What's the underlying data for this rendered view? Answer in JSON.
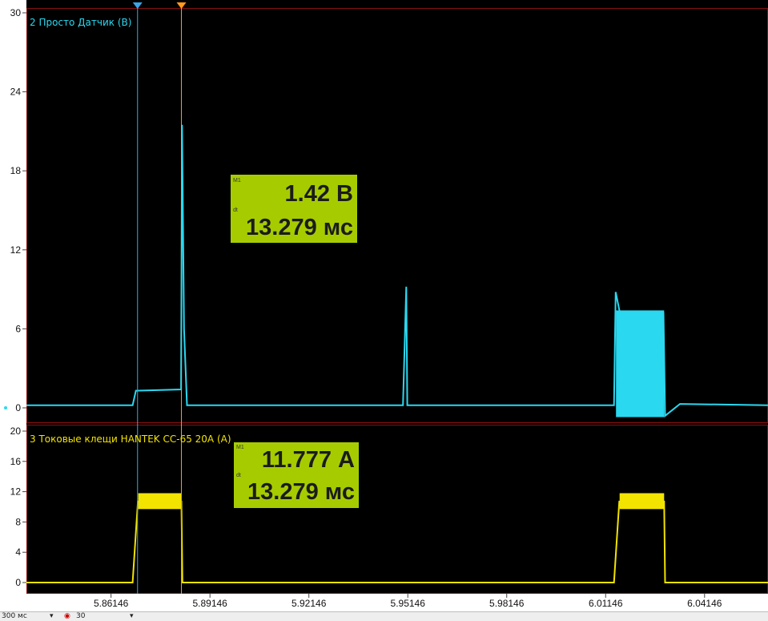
{
  "channels": {
    "ch2": {
      "label": "2 Просто Датчик (В)",
      "color": "#2ad8f0"
    },
    "ch3": {
      "label": "3 Токовые клещи HANTEK CC-65 20A (A)",
      "color": "#f2e300"
    }
  },
  "measurements": {
    "m1": {
      "tag1": "M1",
      "value": "1.42 В",
      "tag2": "dt",
      "dt": "13.279 мс"
    },
    "m2": {
      "tag1": "M1",
      "value": "11.777 А",
      "tag2": "dt",
      "dt": "13.279 мс"
    }
  },
  "cursors": {
    "a": {
      "color": "#3aa6e6",
      "t": 5.8695
    },
    "b": {
      "color": "#ff9a1e",
      "t": 5.8828
    }
  },
  "statusbar": {
    "timebase": "300 мс",
    "count": "30"
  },
  "colors": {
    "grid_border": "#8a0f0f",
    "measure_bg": "#a6cc00"
  },
  "chart_data": [
    {
      "type": "line",
      "series": [
        {
          "name": "2 Просто Датчик (В)"
        }
      ],
      "y_ticks": [
        "30",
        "24",
        "18",
        "12",
        "6",
        "0"
      ],
      "ylim": [
        0,
        30
      ],
      "xlim": [
        5.8358,
        6.0607
      ],
      "signal": [
        [
          5.8358,
          0.2
        ],
        [
          5.868,
          0.2
        ],
        [
          5.869,
          1.3
        ],
        [
          5.8827,
          1.4
        ],
        [
          5.883,
          21.5
        ],
        [
          5.8836,
          6
        ],
        [
          5.8845,
          0.2
        ],
        [
          5.95,
          0.2
        ],
        [
          5.951,
          9.2
        ],
        [
          5.9513,
          0.2
        ],
        [
          6.014,
          0.2
        ],
        [
          6.0145,
          8.8
        ],
        [
          6.0158,
          7.2
        ],
        [
          6.029,
          7.2
        ],
        [
          6.0295,
          -0.6
        ],
        [
          6.034,
          0.3
        ],
        [
          6.0607,
          0.2
        ]
      ]
    },
    {
      "type": "line",
      "series": [
        {
          "name": "3 Токовые клещи HANTEK CC-65 20A (A)"
        }
      ],
      "y_ticks": [
        "20",
        "16",
        "12",
        "8",
        "4",
        "0"
      ],
      "ylim": [
        0,
        20
      ],
      "x_ticks": [
        "5.86146",
        "5.89146",
        "5.92146",
        "5.95146",
        "5.98146",
        "6.01146",
        "6.04146"
      ],
      "x_tick_values": [
        5.86146,
        5.89146,
        5.92146,
        5.95146,
        5.98146,
        6.01146,
        6.04146
      ],
      "xlim": [
        5.8358,
        6.0607
      ],
      "signal": [
        [
          5.8358,
          0
        ],
        [
          5.868,
          0
        ],
        [
          5.8696,
          10.7
        ],
        [
          5.8828,
          10.7
        ],
        [
          5.8831,
          0
        ],
        [
          6.014,
          0
        ],
        [
          6.0156,
          10.7
        ],
        [
          6.0292,
          10.7
        ],
        [
          6.0295,
          0
        ],
        [
          6.0607,
          0
        ]
      ]
    }
  ]
}
